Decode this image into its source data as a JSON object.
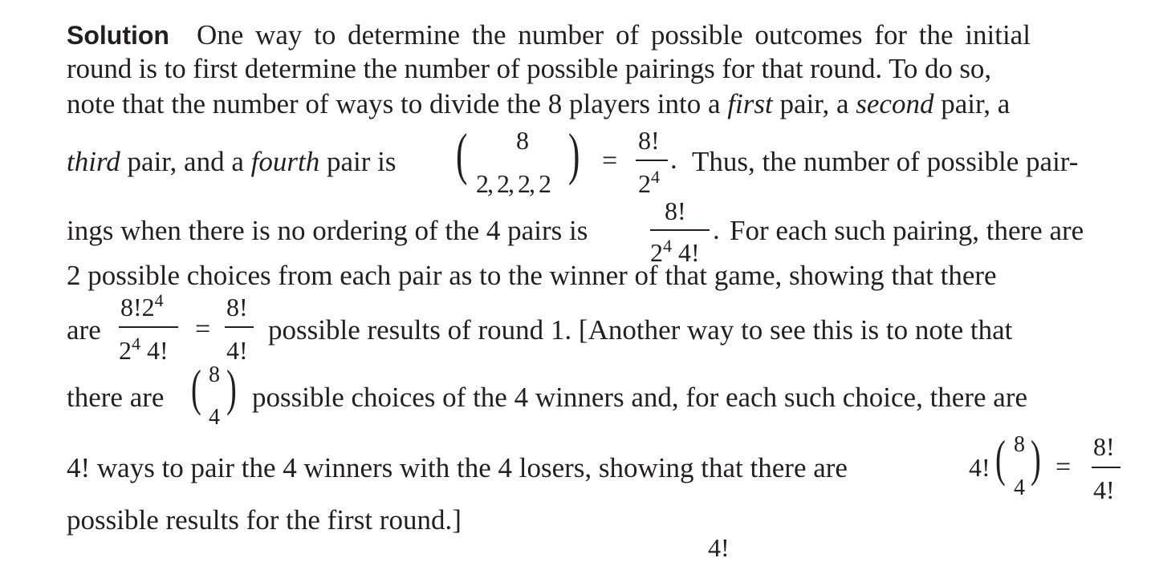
{
  "solution": {
    "label": "Solution",
    "line1_text": "One way to determine the number of possible outcomes for the initial",
    "line2_text": "round is to first determine the number of possible pairings for that round. To do so,",
    "line3_pre": "note that the number of ways to divide the 8 players into a",
    "line3_em1": "first",
    "line3_mid": "pair, a",
    "line3_em2": "second",
    "line3_post": "pair, a",
    "line4_em1": "third",
    "line4_mid1": "pair, and a",
    "line4_em2": "fourth",
    "line4_mid2": "pair is",
    "line4_post": "Thus, the number of possible pair-",
    "line5_pre": "ings when there is no ordering of the 4 pairs is",
    "line5_post": "For each such pairing, there are",
    "line6_text": "2 possible choices from each pair as to the winner of that game, showing that there",
    "line7_pre": "are",
    "line7_post": "possible results of round 1. [Another way to see this is to note that",
    "line8_pre": "there are",
    "line8_post": "possible choices of the 4 winners and, for each such choice, there are",
    "line9_pre": "4! ways to pair the 4 winners with the 4 losers, showing that there are",
    "line10_text": "possible results for the first round.]"
  },
  "math": {
    "multinomial_top": "8",
    "multinomial_bottom": "2, 2, 2, 2",
    "eq": "=",
    "frac1_num": "8!",
    "frac1_den_base": "2",
    "frac1_den_exp": "4",
    "frac2_num": "8!",
    "frac2_den_base": "2",
    "frac2_den_exp": "4",
    "frac2_den_post": "4!",
    "frac3_num_base": "8!2",
    "frac3_num_exp": "4",
    "frac3_den_base": "2",
    "frac3_den_exp": "4",
    "frac3_den_post": "4!",
    "frac4_num": "8!",
    "frac4_den": "4!",
    "binom_top": "8",
    "binom_bottom": "4",
    "line9_coef": "4!",
    "frac5_num": "8!",
    "frac5_den": "4!",
    "period": ".",
    "lparen": "(",
    "rparen": ")"
  },
  "footer": {
    "cutoff_text": "4!"
  }
}
